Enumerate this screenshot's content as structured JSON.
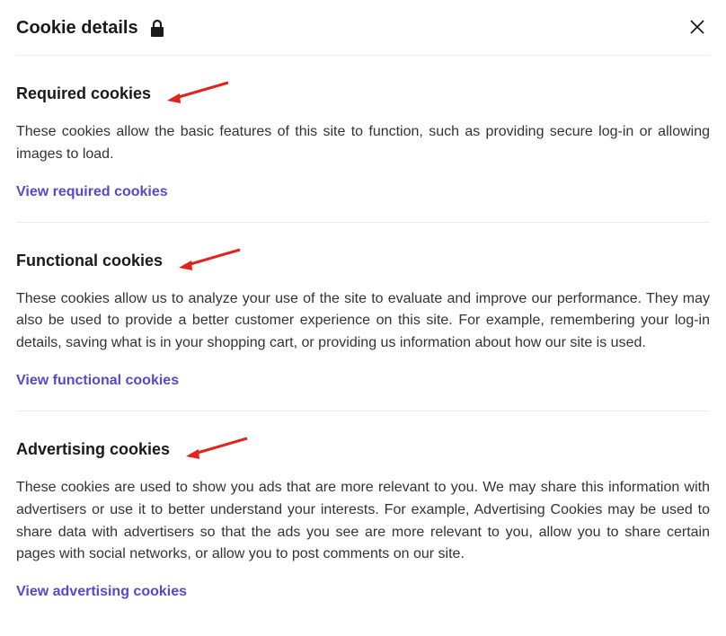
{
  "header": {
    "title": "Cookie details"
  },
  "sections": [
    {
      "heading": "Required cookies",
      "description": "These cookies allow the basic features of this site to function, such as providing secure log-in or allowing images to load.",
      "link_label": "View required cookies"
    },
    {
      "heading": "Functional cookies",
      "description": "These cookies allow us to analyze your use of the site to evaluate and improve our performance. They may also be used to provide a better customer experience on this site. For example, remembering your log-in details, saving what is in your shopping cart, or providing us information about how our site is used.",
      "link_label": "View functional cookies"
    },
    {
      "heading": "Advertising cookies",
      "description": "These cookies are used to show you ads that are more relevant to you. We may share this information with advertisers or use it to better understand your interests. For example, Advertising Cookies may be used to share data with advertisers so that the ads you see are more relevant to you, allow you to share certain pages with social networks, or allow you to post comments on our site.",
      "link_label": "View advertising cookies"
    }
  ]
}
